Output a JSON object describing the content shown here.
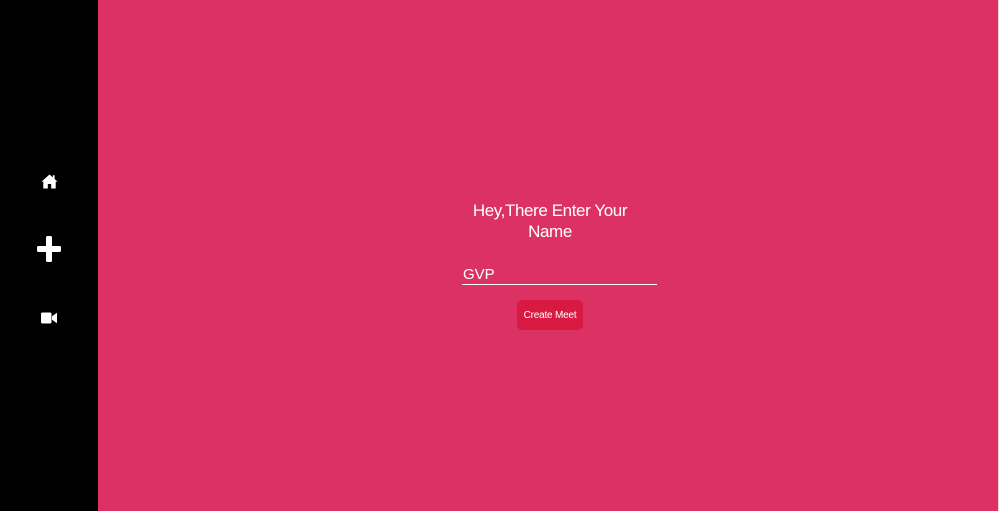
{
  "sidebar": {
    "items": [
      {
        "icon": "home-icon"
      },
      {
        "icon": "plus-icon"
      },
      {
        "icon": "video-camera-icon"
      }
    ]
  },
  "main": {
    "heading": "Hey,There Enter Your Name",
    "name_input": {
      "value": "GVP"
    },
    "create_button_label": "Create Meet"
  },
  "colors": {
    "sidebar_bg": "#000000",
    "main_bg": "#dc3263",
    "button_bg": "#d81942",
    "text": "#ffffff"
  }
}
